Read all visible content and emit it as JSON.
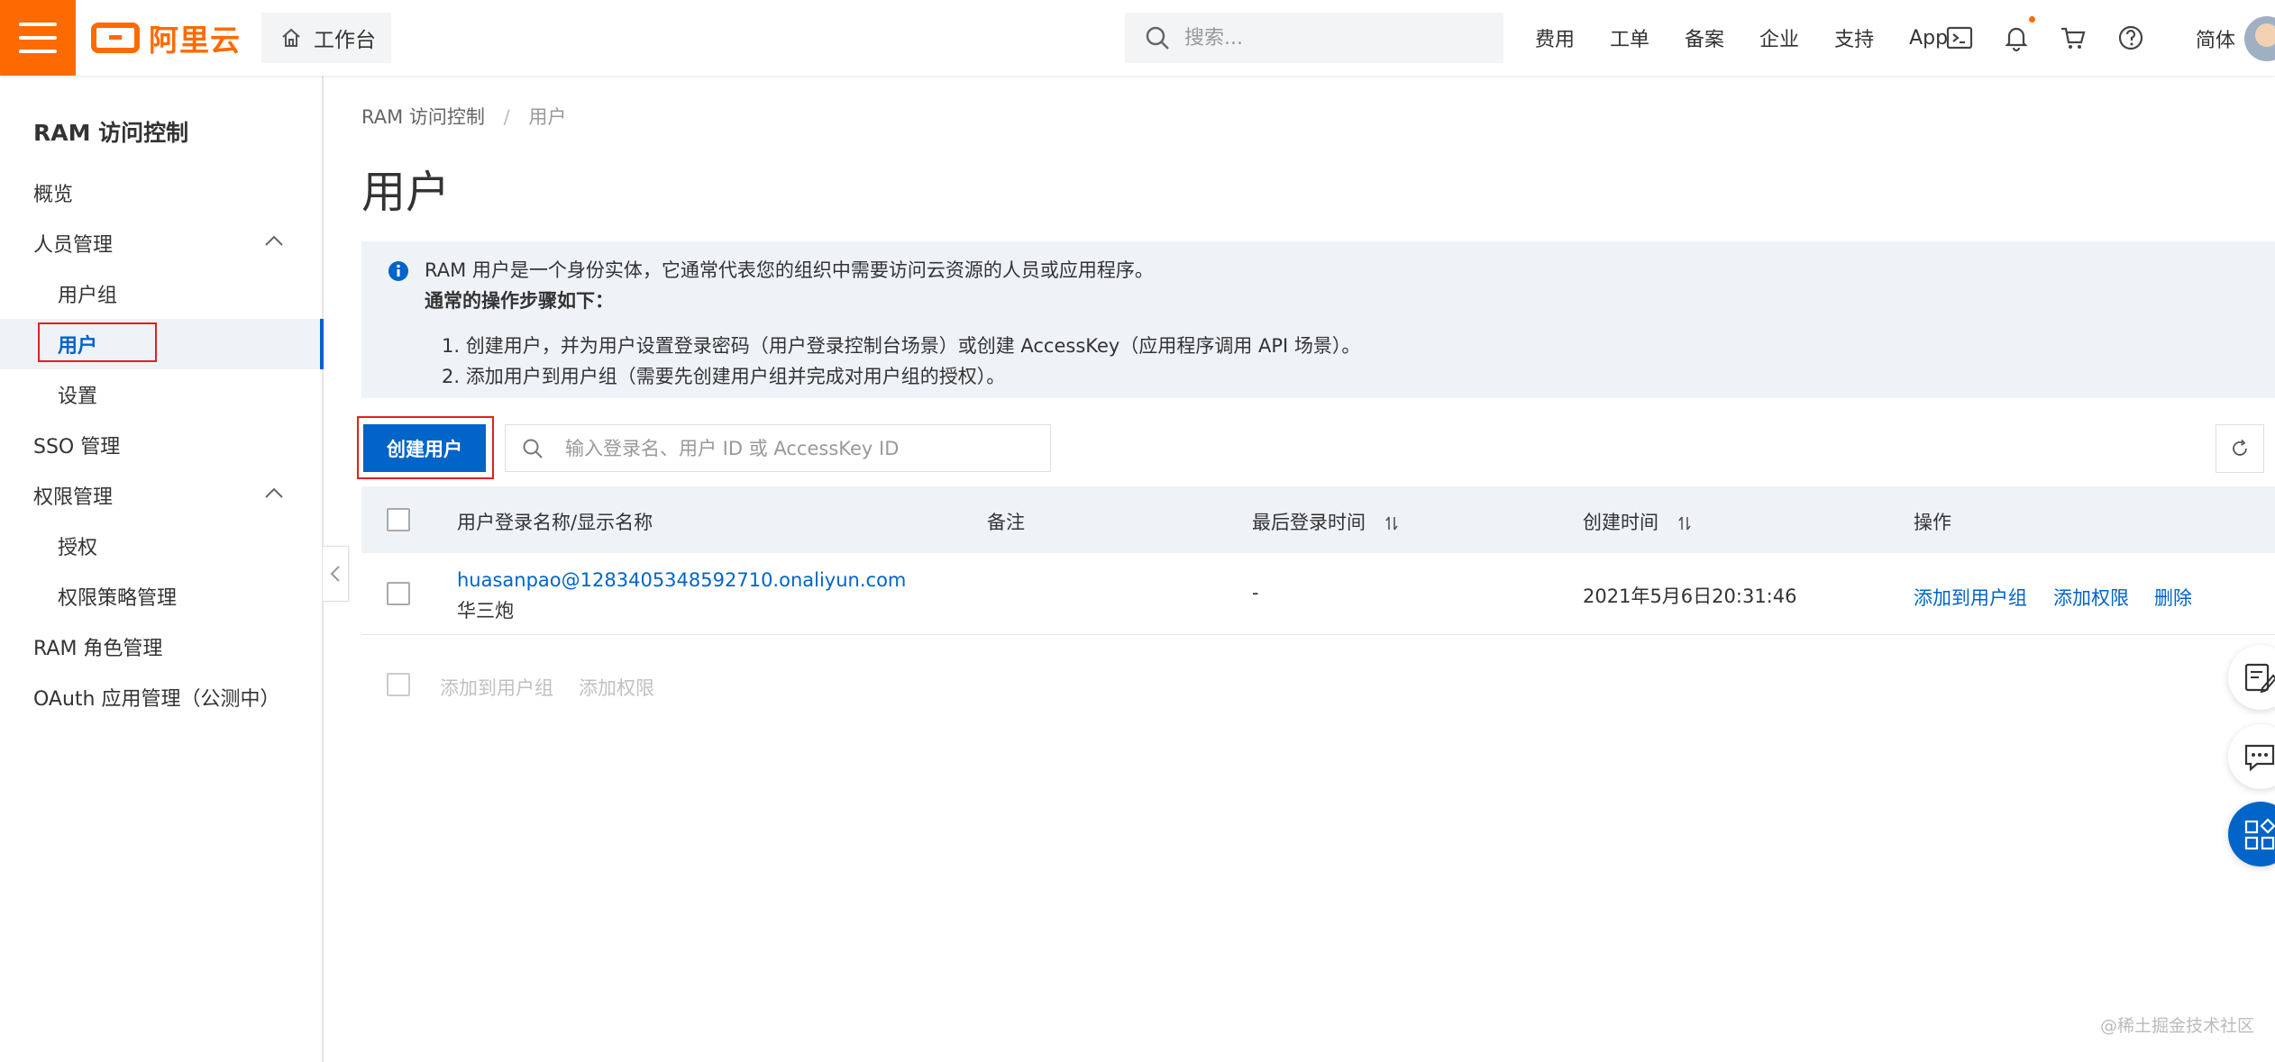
{
  "brand": {
    "logo_text": "阿里云",
    "accent": "#ff6a00",
    "link_color": "#0064c8"
  },
  "topbar": {
    "workbench_label": "工作台",
    "search_placeholder": "搜索...",
    "nav": [
      "费用",
      "工单",
      "备案",
      "企业",
      "支持",
      "App"
    ],
    "icons": [
      "terminal-icon",
      "bell-icon",
      "cart-icon",
      "help-icon"
    ],
    "lang": "简体"
  },
  "sidebar": {
    "title": "RAM 访问控制",
    "items": [
      {
        "label": "概览"
      },
      {
        "label": "人员管理"
      },
      {
        "label": "用户组"
      },
      {
        "label": "用户"
      },
      {
        "label": "设置"
      },
      {
        "label": "SSO 管理"
      },
      {
        "label": "权限管理"
      },
      {
        "label": "授权"
      },
      {
        "label": "权限策略管理"
      },
      {
        "label": "RAM 角色管理"
      },
      {
        "label": "OAuth 应用管理（公测中）"
      }
    ]
  },
  "main": {
    "breadcrumb": [
      "RAM 访问控制",
      "用户"
    ],
    "page_title": "用户",
    "notice": {
      "line1": "RAM 用户是一个身份实体，它通常代表您的组织中需要访问云资源的人员或应用程序。",
      "heading": "通常的操作步骤如下：",
      "step1": "1. 创建用户，并为用户设置登录密码（用户登录控制台场景）或创建 AccessKey（应用程序调用 API 场景）。",
      "step2": "2. 添加用户到用户组（需要先创建用户组并完成对用户组的授权）。"
    },
    "create_button": "创建用户",
    "search_placeholder": "输入登录名、用户 ID 或 AccessKey ID",
    "table": {
      "columns": [
        "用户登录名称/显示名称",
        "备注",
        "最后登录时间",
        "创建时间",
        "操作"
      ],
      "rows": [
        {
          "login_name": "huasanpao@1283405348592710.onaliyun.com",
          "display_name": "华三炮",
          "remark": "",
          "last_login": "-",
          "created": "2021年5月6日20:31:46",
          "actions": [
            "添加到用户组",
            "添加权限",
            "删除"
          ]
        }
      ]
    },
    "bulk_actions": [
      "添加到用户组",
      "添加权限"
    ]
  },
  "watermark": "@稀土掘金技术社区"
}
